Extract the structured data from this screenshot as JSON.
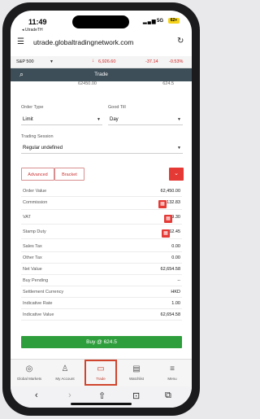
{
  "status": {
    "time": "11:49",
    "back_app": "◂ UtradeTH",
    "network": "5G",
    "battery": "62+"
  },
  "browser": {
    "url": "utrade.globaltradingnetwork.com"
  },
  "ticker": {
    "name": "S&P 500",
    "price": "6,926.60",
    "change": "-37.14",
    "change_pct": "-0.53%"
  },
  "header": {
    "title": "Trade"
  },
  "prev_values": {
    "left": "62450.00",
    "right": "624.5"
  },
  "order": {
    "order_type_label": "Order Type",
    "order_type_value": "Limit",
    "good_till_label": "Good Till",
    "good_till_value": "Day",
    "session_label": "Trading Session",
    "session_value": "Regular undefined"
  },
  "buttons": {
    "advanced": "Advanced",
    "bracket": "Bracket"
  },
  "summary": {
    "order_value": {
      "label": "Order Value",
      "value": "62,450.00"
    },
    "commission": {
      "label": "Commission",
      "value": "132.83"
    },
    "vat": {
      "label": "VAT",
      "value": "9.30"
    },
    "stamp_duty": {
      "label": "Stamp Duty",
      "value": "62.45"
    },
    "sales_tax": {
      "label": "Sales Tax",
      "value": "0.00"
    },
    "other_tax": {
      "label": "Other Tax",
      "value": "0.00"
    },
    "net_value": {
      "label": "Net Value",
      "value": "62,654.58"
    },
    "buy_pending": {
      "label": "Buy Pending",
      "value": "--"
    },
    "settlement_currency": {
      "label": "Settlement Currency",
      "value": "HKD"
    },
    "indicative_rate": {
      "label": "Indicative Rate",
      "value": "1.00"
    },
    "indicative_value": {
      "label": "Indicative Value",
      "value": "62,654.58"
    }
  },
  "buy_button": "Buy @ 624.5",
  "tabs": [
    {
      "label": "Global Markets",
      "icon": "globe-icon"
    },
    {
      "label": "My Account",
      "icon": "person-icon"
    },
    {
      "label": "Trade",
      "icon": "wallet-icon"
    },
    {
      "label": "Watchlist",
      "icon": "table-icon"
    },
    {
      "label": "Menu",
      "icon": "hamburger-icon"
    }
  ],
  "colors": {
    "accent_red": "#e53935",
    "buy_green": "#2e9e3c",
    "nav_bar": "#3e4e59"
  }
}
